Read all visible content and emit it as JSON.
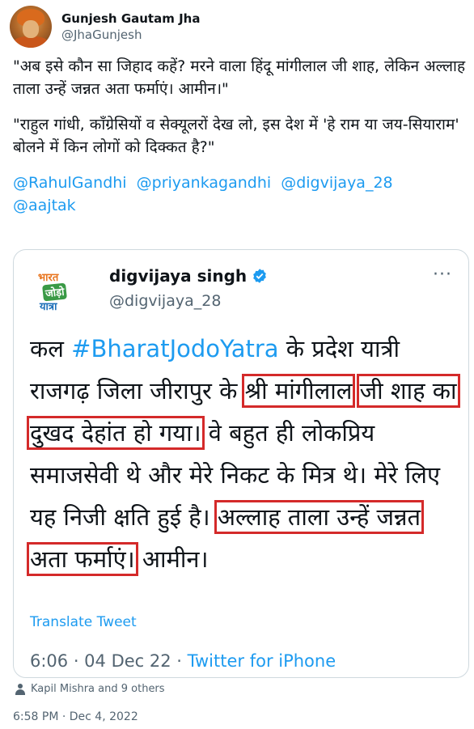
{
  "author": {
    "name": "Gunjesh Gautam Jha",
    "handle": "@JhaGunjesh"
  },
  "tweet": {
    "paragraph1": "\"अब इसे कौन सा जिहाद कहें? मरने वाला हिंदू मांगीलाल जी शाह, लेकिन अल्लाह ताला उन्हें जन्नत अता फर्माएं। आमीन।\"",
    "paragraph2": "\"राहुल गांधी, कॉंग्रेसियों व सेक्यूलरों देख लो, इस देश में 'हे राम या जय-सियाराम' बोलने में किन लोगों को दिक्कत है?\"",
    "mentions": [
      "@RahulGandhi",
      "@priyankagandhi",
      "@digvijaya_28",
      "@aajtak"
    ]
  },
  "quoted": {
    "logo_lines": [
      "भारत",
      "जोड़ो",
      "यात्रा"
    ],
    "name": "digvijaya singh",
    "handle": "@digvijaya_28",
    "text_parts": {
      "p1": "कल ",
      "hashtag": "#BharatJodoYatra",
      "p2": " के प्रदेश यात्री राजगढ़ जिला जीरापुर के ",
      "boxed1": "श्री मांगीलाल",
      "p3": " ",
      "boxed2": "जी शाह का दुखद देहांत हो गया।",
      "p4": " वे बहुत ही लोकप्रिय समाजसेवी थे और मेरे निकट के मित्र थे। मेरे लिए यह निजी क्षति हुई है। ",
      "boxed3": "अल्लाह ताला उन्हें जन्नत अता फर्माएं।",
      "p5": " आमीन।"
    },
    "translate_label": "Translate Tweet",
    "time_date": "6:06 · 04 Dec 22 · ",
    "source": "Twitter for iPhone"
  },
  "liked_by": "Kapil Mishra and 9 others",
  "timestamp": "6:58 PM · Dec 4, 2022",
  "colors": {
    "link": "#1d9bf0",
    "secondary": "#536471",
    "highlight_box": "#d42a2a"
  },
  "icons": [
    "avatar",
    "verified-badge-icon",
    "more-options-icon",
    "person-icon"
  ]
}
